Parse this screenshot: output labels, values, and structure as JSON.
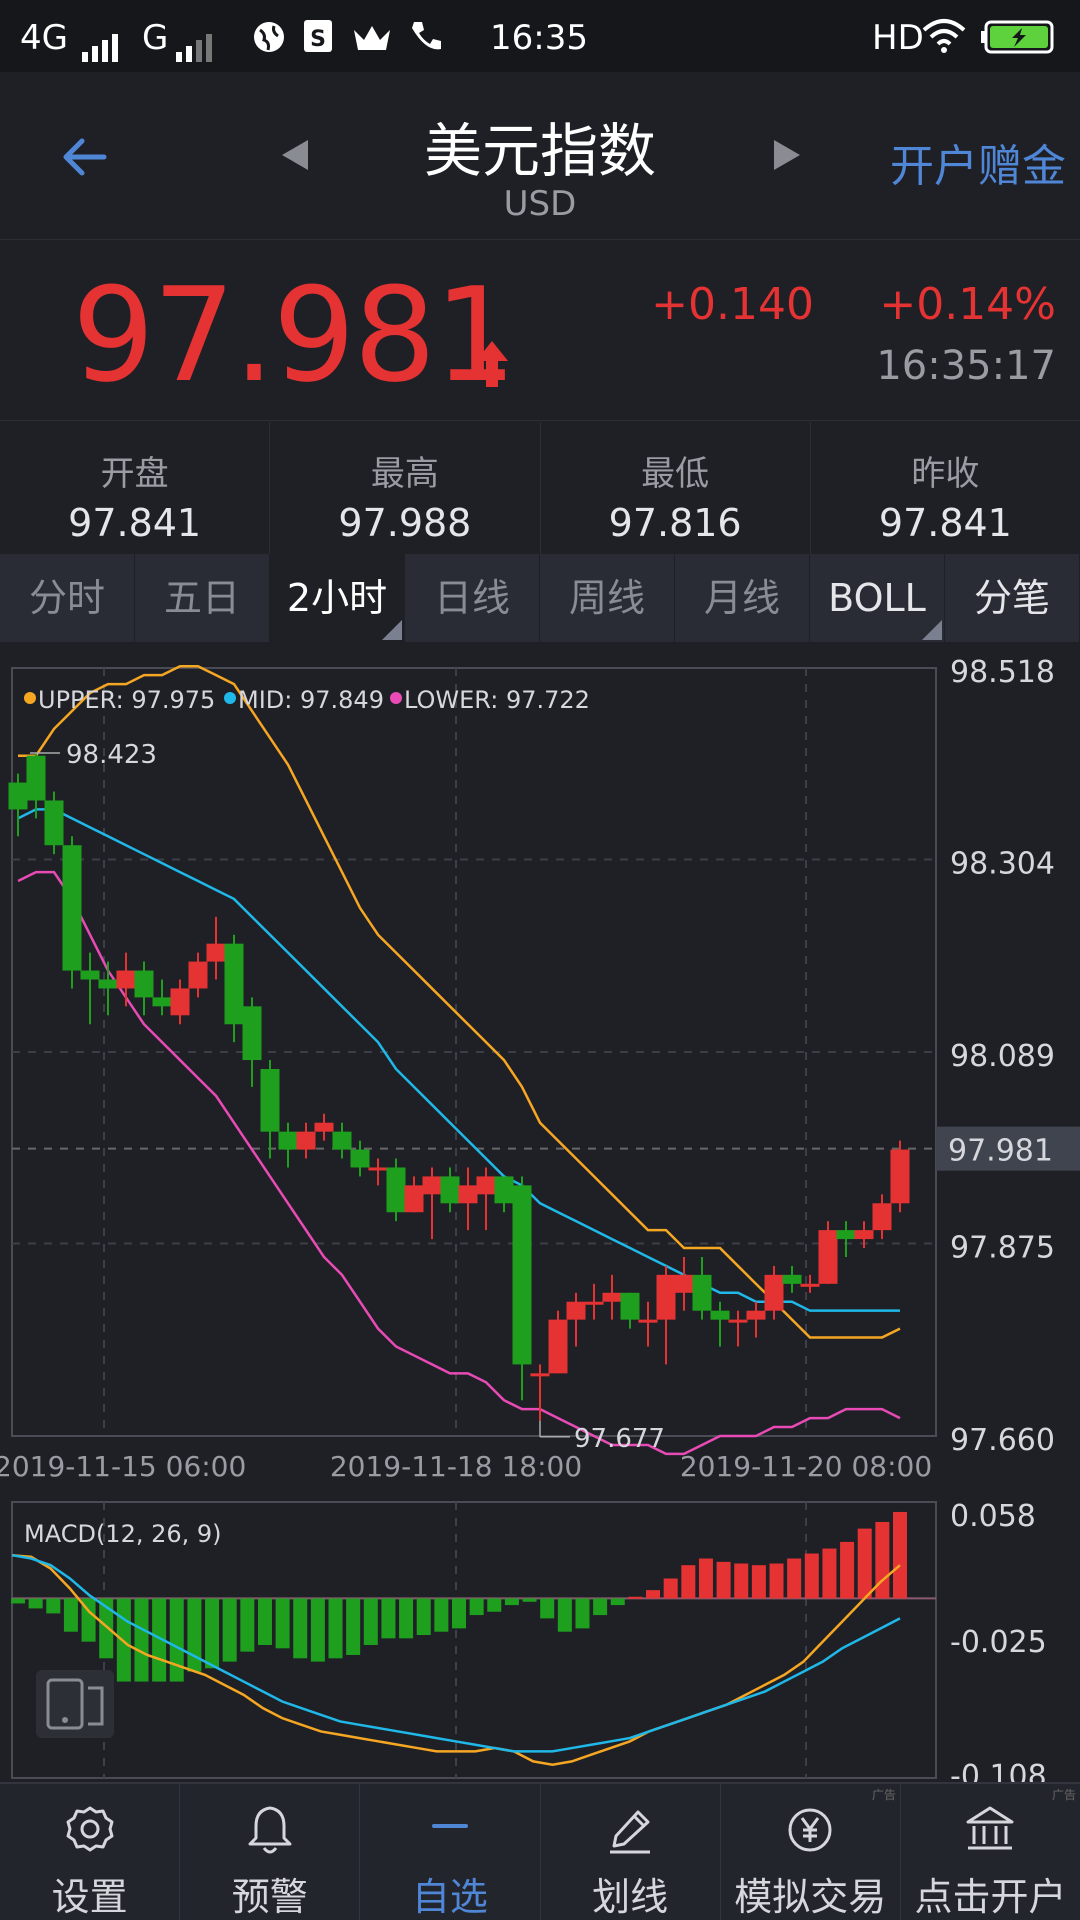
{
  "status_bar": {
    "network1": "4G",
    "network2": "G",
    "time": "16:35",
    "hd": "HD",
    "icons": [
      "signal-icon",
      "globe-icon",
      "sim-card-icon",
      "crown-icon",
      "phone-icon",
      "wifi-icon",
      "battery-charging-icon"
    ]
  },
  "header": {
    "title": "美元指数",
    "subtitle": "USD",
    "promo": "开户赠金",
    "icons": [
      "back-arrow-icon",
      "prev-triangle-icon",
      "next-triangle-icon"
    ]
  },
  "quote": {
    "price": "97.981",
    "change": "+0.140",
    "change_pct": "+0.14%",
    "time": "16:35:17",
    "color": "#e53232"
  },
  "stats": [
    {
      "label": "开盘",
      "value": "97.841"
    },
    {
      "label": "最高",
      "value": "97.988"
    },
    {
      "label": "最低",
      "value": "97.816"
    },
    {
      "label": "昨收",
      "value": "97.841"
    }
  ],
  "tabs": [
    {
      "label": "分时"
    },
    {
      "label": "五日"
    },
    {
      "label": "2小时"
    },
    {
      "label": "日线"
    },
    {
      "label": "周线"
    },
    {
      "label": "月线"
    },
    {
      "label": "BOLL"
    },
    {
      "label": "分笔"
    }
  ],
  "chart_data": [
    {
      "type": "candlestick",
      "indicator": "BOLL",
      "legend": [
        {
          "label": "UPPER: 97.975",
          "color": "#f5a623"
        },
        {
          "label": "MID: 97.849",
          "color": "#1fb8e8"
        },
        {
          "label": "LOWER: 97.722",
          "color": "#e84bb5"
        }
      ],
      "y_ticks": [
        "98.518",
        "98.304",
        "98.089",
        "97.875",
        "97.660"
      ],
      "ylim": [
        97.66,
        98.518
      ],
      "current_price_label": "97.981",
      "max_label": "98.423",
      "min_label": "97.677",
      "x_ticks": [
        "2019-11-15 06:00",
        "2019-11-18 18:00",
        "2019-11-20 08:00"
      ],
      "candles": [
        [
          98.39,
          98.36,
          98.4,
          98.33
        ],
        [
          98.42,
          98.37,
          98.423,
          98.35
        ],
        [
          98.37,
          98.32,
          98.38,
          98.31
        ],
        [
          98.32,
          98.18,
          98.33,
          98.16
        ],
        [
          98.18,
          98.17,
          98.2,
          98.12
        ],
        [
          98.17,
          98.16,
          98.19,
          98.13
        ],
        [
          98.16,
          98.18,
          98.2,
          98.14
        ],
        [
          98.18,
          98.15,
          98.19,
          98.13
        ],
        [
          98.15,
          98.14,
          98.17,
          98.13
        ],
        [
          98.13,
          98.16,
          98.17,
          98.12
        ],
        [
          98.16,
          98.19,
          98.2,
          98.15
        ],
        [
          98.19,
          98.21,
          98.24,
          98.17
        ],
        [
          98.21,
          98.12,
          98.22,
          98.1
        ],
        [
          98.14,
          98.08,
          98.15,
          98.05
        ],
        [
          98.07,
          98.0,
          98.08,
          97.97
        ],
        [
          98.0,
          97.98,
          98.01,
          97.96
        ],
        [
          97.98,
          98.0,
          98.01,
          97.97
        ],
        [
          98.0,
          98.01,
          98.02,
          97.99
        ],
        [
          98.0,
          97.98,
          98.01,
          97.97
        ],
        [
          97.98,
          97.96,
          97.99,
          97.95
        ],
        [
          97.96,
          97.96,
          97.97,
          97.94
        ],
        [
          97.96,
          97.91,
          97.97,
          97.9
        ],
        [
          97.91,
          97.94,
          97.95,
          97.91
        ],
        [
          97.93,
          97.95,
          97.96,
          97.88
        ],
        [
          97.95,
          97.92,
          97.96,
          97.91
        ],
        [
          97.92,
          97.94,
          97.96,
          97.89
        ],
        [
          97.93,
          97.95,
          97.96,
          97.89
        ],
        [
          97.95,
          97.92,
          97.95,
          97.91
        ],
        [
          97.94,
          97.74,
          97.95,
          97.7
        ],
        [
          97.73,
          97.73,
          97.74,
          97.677
        ],
        [
          97.73,
          97.79,
          97.8,
          97.73
        ],
        [
          97.79,
          97.81,
          97.82,
          97.76
        ],
        [
          97.81,
          97.81,
          97.83,
          97.79
        ],
        [
          97.81,
          97.82,
          97.84,
          97.79
        ],
        [
          97.82,
          97.79,
          97.82,
          97.78
        ],
        [
          97.79,
          97.79,
          97.81,
          97.76
        ],
        [
          97.79,
          97.84,
          97.85,
          97.74
        ],
        [
          97.82,
          97.84,
          97.86,
          97.8
        ],
        [
          97.84,
          97.8,
          97.86,
          97.79
        ],
        [
          97.8,
          97.79,
          97.81,
          97.76
        ],
        [
          97.79,
          97.79,
          97.8,
          97.76
        ],
        [
          97.79,
          97.8,
          97.81,
          97.77
        ],
        [
          97.8,
          97.84,
          97.85,
          97.79
        ],
        [
          97.84,
          97.83,
          97.85,
          97.82
        ],
        [
          97.83,
          97.83,
          97.84,
          97.82
        ],
        [
          97.83,
          97.89,
          97.9,
          97.83
        ],
        [
          97.89,
          97.88,
          97.9,
          97.86
        ],
        [
          97.88,
          97.89,
          97.9,
          97.87
        ],
        [
          97.89,
          97.92,
          97.93,
          97.88
        ],
        [
          97.92,
          97.98,
          97.99,
          97.91
        ]
      ],
      "upper": [
        98.42,
        98.42,
        98.45,
        98.47,
        98.49,
        98.5,
        98.5,
        98.51,
        98.51,
        98.52,
        98.52,
        98.51,
        98.5,
        98.47,
        98.44,
        98.41,
        98.37,
        98.33,
        98.29,
        98.25,
        98.22,
        98.2,
        98.18,
        98.16,
        98.14,
        98.12,
        98.1,
        98.08,
        98.05,
        98.01,
        97.99,
        97.97,
        97.95,
        97.93,
        97.91,
        97.89,
        97.89,
        97.87,
        97.87,
        97.87,
        97.85,
        97.83,
        97.81,
        97.79,
        97.77,
        97.77,
        97.77,
        97.77,
        97.77,
        97.78
      ],
      "mid": [
        98.35,
        98.36,
        98.36,
        98.35,
        98.34,
        98.33,
        98.32,
        98.31,
        98.3,
        98.29,
        98.28,
        98.27,
        98.26,
        98.24,
        98.22,
        98.2,
        98.18,
        98.16,
        98.14,
        98.12,
        98.1,
        98.07,
        98.05,
        98.03,
        98.01,
        97.99,
        97.97,
        97.95,
        97.94,
        97.92,
        97.91,
        97.9,
        97.89,
        97.88,
        97.87,
        97.86,
        97.85,
        97.84,
        97.83,
        97.82,
        97.82,
        97.81,
        97.81,
        97.81,
        97.8,
        97.8,
        97.8,
        97.8,
        97.8,
        97.8
      ],
      "lower": [
        98.28,
        98.29,
        98.29,
        98.26,
        98.22,
        98.18,
        98.15,
        98.12,
        98.1,
        98.08,
        98.06,
        98.04,
        98.01,
        97.98,
        97.95,
        97.92,
        97.89,
        97.86,
        97.84,
        97.81,
        97.78,
        97.76,
        97.75,
        97.74,
        97.73,
        97.73,
        97.72,
        97.7,
        97.69,
        97.69,
        97.68,
        97.67,
        97.66,
        97.65,
        97.65,
        97.65,
        97.64,
        97.64,
        97.65,
        97.66,
        97.66,
        97.66,
        97.67,
        97.67,
        97.68,
        97.68,
        97.69,
        97.69,
        97.69,
        97.68
      ]
    },
    {
      "type": "bar",
      "indicator": "MACD",
      "title": "MACD(12, 26, 9)",
      "y_ticks": [
        "0.058",
        "-0.025",
        "-0.108"
      ],
      "ylim": [
        -0.108,
        0.058
      ],
      "hist": [
        -0.003,
        -0.006,
        -0.009,
        -0.02,
        -0.026,
        -0.036,
        -0.05,
        -0.05,
        -0.05,
        -0.05,
        -0.044,
        -0.042,
        -0.038,
        -0.032,
        -0.028,
        -0.03,
        -0.036,
        -0.038,
        -0.036,
        -0.034,
        -0.028,
        -0.024,
        -0.024,
        -0.022,
        -0.02,
        -0.018,
        -0.01,
        -0.008,
        -0.004,
        -0.002,
        -0.012,
        -0.02,
        -0.018,
        -0.01,
        -0.004,
        0.001,
        0.005,
        0.012,
        0.02,
        0.024,
        0.022,
        0.021,
        0.02,
        0.021,
        0.024,
        0.027,
        0.03,
        0.034,
        0.042,
        0.046,
        0.052
      ],
      "dif": [
        0.026,
        0.025,
        0.018,
        0.006,
        -0.008,
        -0.018,
        -0.028,
        -0.034,
        -0.038,
        -0.042,
        -0.046,
        -0.052,
        -0.058,
        -0.066,
        -0.072,
        -0.076,
        -0.08,
        -0.082,
        -0.084,
        -0.086,
        -0.088,
        -0.09,
        -0.092,
        -0.092,
        -0.092,
        -0.09,
        -0.092,
        -0.098,
        -0.1,
        -0.098,
        -0.094,
        -0.09,
        -0.086,
        -0.08,
        -0.076,
        -0.072,
        -0.068,
        -0.064,
        -0.058,
        -0.052,
        -0.046,
        -0.038,
        -0.026,
        -0.014,
        -0.002,
        0.01,
        0.02
      ],
      "dea": [
        0.026,
        0.024,
        0.02,
        0.012,
        0.002,
        -0.006,
        -0.014,
        -0.02,
        -0.026,
        -0.032,
        -0.038,
        -0.044,
        -0.05,
        -0.056,
        -0.062,
        -0.066,
        -0.07,
        -0.074,
        -0.076,
        -0.078,
        -0.08,
        -0.082,
        -0.084,
        -0.086,
        -0.088,
        -0.09,
        -0.092,
        -0.092,
        -0.092,
        -0.09,
        -0.088,
        -0.086,
        -0.084,
        -0.08,
        -0.076,
        -0.072,
        -0.068,
        -0.064,
        -0.06,
        -0.056,
        -0.05,
        -0.044,
        -0.038,
        -0.03,
        -0.024,
        -0.018,
        -0.012
      ]
    }
  ],
  "bottom_nav": [
    {
      "label": "设置",
      "icon": "gear-icon"
    },
    {
      "label": "预警",
      "icon": "bell-icon"
    },
    {
      "label": "自选",
      "icon": "minus-icon"
    },
    {
      "label": "划线",
      "icon": "pencil-icon"
    },
    {
      "label": "模拟交易",
      "icon": "yen-coin-icon"
    },
    {
      "label": "点击开户",
      "icon": "bank-icon"
    }
  ],
  "ad_label": "广告"
}
